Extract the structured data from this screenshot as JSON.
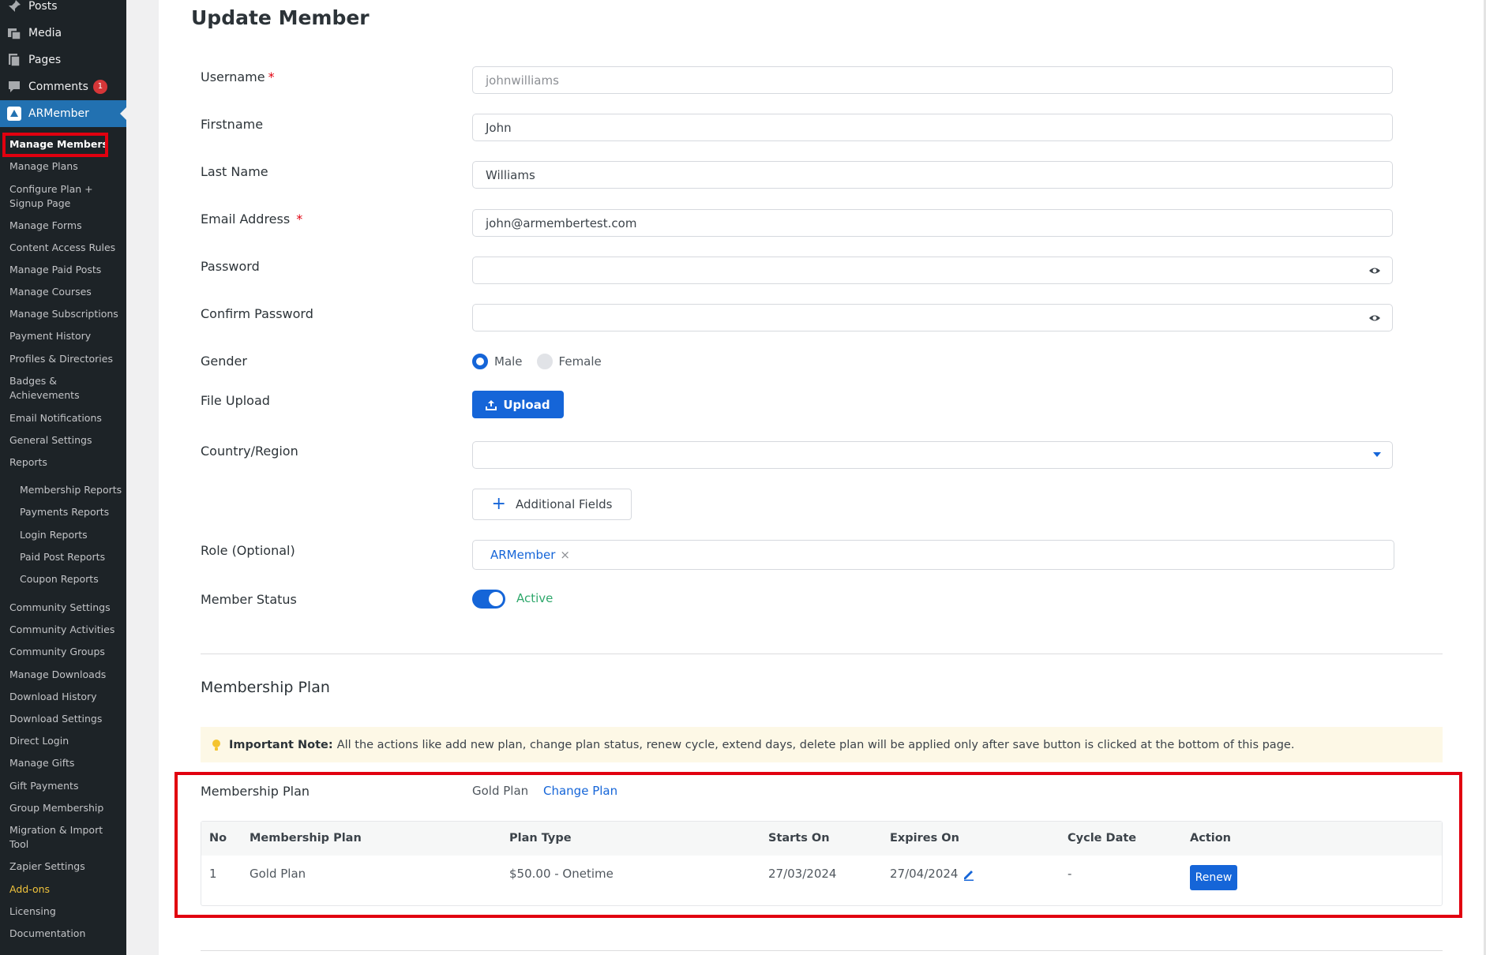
{
  "sidebar": {
    "top_items": [
      {
        "label": "Posts",
        "icon": "pin-icon"
      },
      {
        "label": "Media",
        "icon": "media-icon"
      },
      {
        "label": "Pages",
        "icon": "pages-icon"
      },
      {
        "label": "Comments",
        "icon": "comment-icon",
        "badge": "1"
      },
      {
        "label": "ARMember",
        "icon": "armember-icon",
        "active": true
      }
    ],
    "menu": [
      "Manage Members",
      "Manage Plans",
      "Configure Plan +",
      "Signup Page",
      "Manage Forms",
      "Content Access Rules",
      "Manage Paid Posts",
      "Manage Courses",
      "Manage Subscriptions",
      "Payment History",
      "Profiles & Directories",
      "Badges &",
      "Achievements",
      "Email Notifications",
      "General Settings",
      "Reports",
      "Membership Reports",
      "Payments Reports",
      "Login Reports",
      "Paid Post Reports",
      "Coupon Reports",
      "Community Settings",
      "Community Activities",
      "Community Groups",
      "Manage Downloads",
      "Download History",
      "Download Settings",
      "Direct Login",
      "Manage Gifts",
      "Gift Payments",
      "Group Membership",
      "Migration & Import",
      "Tool",
      "Zapier Settings",
      "Add-ons",
      "Licensing",
      "Documentation"
    ]
  },
  "page": {
    "title": "Update Member"
  },
  "form": {
    "username_label": "Username",
    "username_value": "johnwilliams",
    "firstname_label": "Firstname",
    "firstname_value": "John",
    "lastname_label": "Last Name",
    "lastname_value": "Williams",
    "email_label": "Email Address",
    "email_value": "john@armembertest.com",
    "password_label": "Password",
    "confirm_password_label": "Confirm Password",
    "gender_label": "Gender",
    "gender_options": [
      "Male",
      "Female"
    ],
    "gender_selected": "Male",
    "file_upload_label": "File Upload",
    "upload_button": "Upload",
    "country_label": "Country/Region",
    "country_value": "",
    "additional_fields_button": "Additional Fields",
    "role_label": "Role (Optional)",
    "role_tag": "ARMember",
    "role_remove": "×",
    "status_label": "Member Status",
    "status_value": "Active",
    "required_mark": "*"
  },
  "membership": {
    "section_title": "Membership Plan",
    "note_title": "Important Note:",
    "note_text": "All the actions like add new plan, change plan status, renew cycle, extend days, delete plan will be applied only after save button is clicked at the bottom of this page.",
    "plan_label": "Membership Plan",
    "plan_value": "Gold Plan",
    "change_plan_link": "Change Plan",
    "table": {
      "headers": [
        "No",
        "Membership Plan",
        "Plan Type",
        "Starts On",
        "Expires On",
        "Cycle Date",
        "Action"
      ],
      "rows": [
        {
          "no": "1",
          "plan": "Gold Plan",
          "type": "$50.00 - Onetime",
          "starts": "27/03/2024",
          "expires": "27/04/2024",
          "cycle": "-",
          "action": "Renew"
        }
      ]
    }
  },
  "colors": {
    "primary": "#1565d8",
    "highlight": "#e1000f",
    "sidebar_bg": "#1d2327",
    "sidebar_active": "#2271b1",
    "status_active": "#2fa86c"
  }
}
